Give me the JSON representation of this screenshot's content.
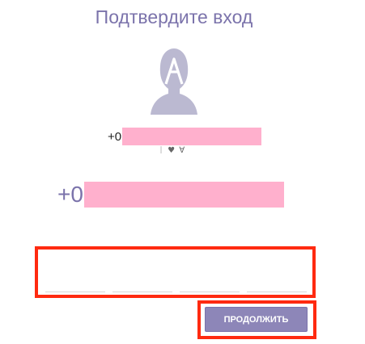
{
  "page": {
    "title": "Подтвердите вход"
  },
  "user": {
    "avatar_icon": "user-silhouette-icon",
    "phone_prefix_small": "+0",
    "sticker": "ᛁ ♥ ∀",
    "phone_prefix_large": "+0",
    "mask_color": "#ffb0cd"
  },
  "code": {
    "digit_1": "",
    "digit_2": "",
    "digit_3": "",
    "digit_4": ""
  },
  "actions": {
    "continue_label": "ПРОДОЛЖИТЬ"
  },
  "colors": {
    "accent": "#7b73ab",
    "button": "#8d86b8",
    "highlight": "#ff2a10"
  }
}
